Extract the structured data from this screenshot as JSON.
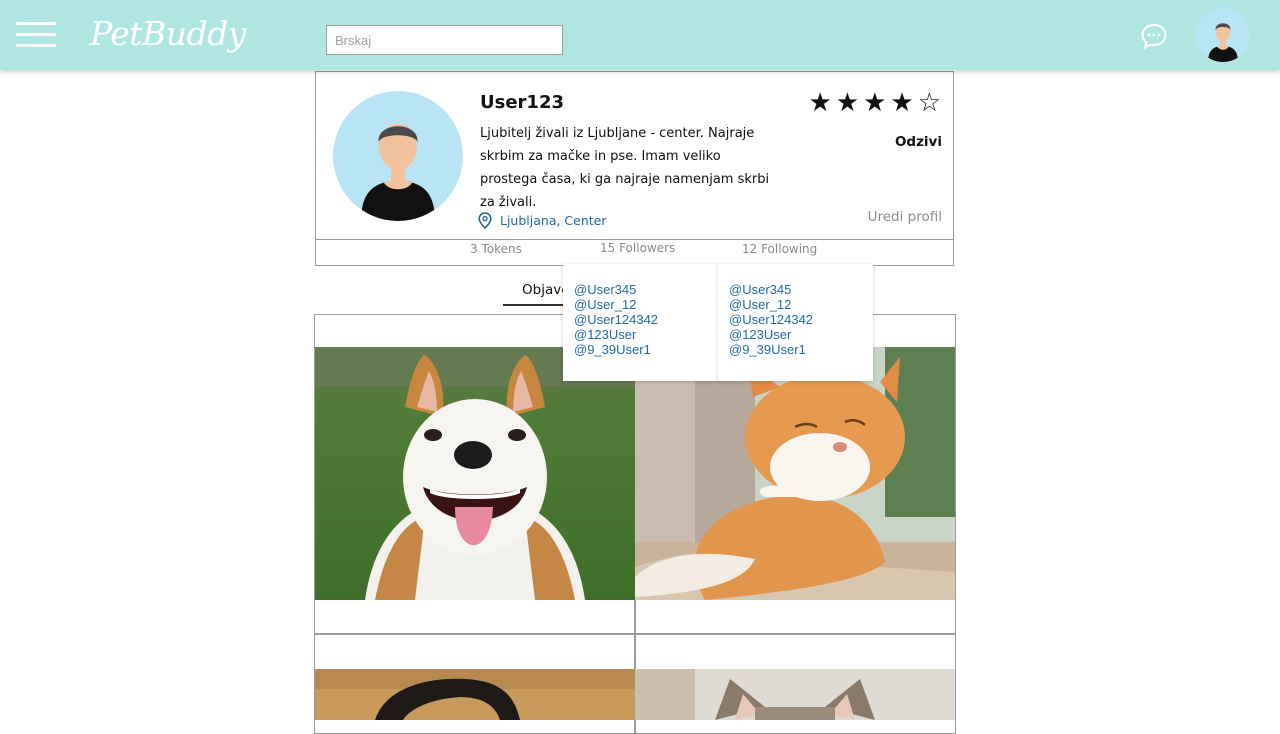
{
  "app": {
    "logo_text": "PetBuddy",
    "accent_color": "#b0e6e2",
    "link_color": "#1f6aa5"
  },
  "header": {
    "search_placeholder": "Brskaj",
    "menu_icon": "hamburger-icon",
    "chat_icon": "chat-bubble-icon"
  },
  "profile": {
    "username": "User123",
    "bio": "Ljubitelj živali iz Ljubljane - center. Najraje skrbim za mačke in pse. Imam veliko prostega časa, ki ga najraje namenjam skrbi za živali.",
    "location": "Ljubljana, Center",
    "rating_stars": [
      "★",
      "★",
      "★",
      "★",
      "☆"
    ],
    "rating_value": 4,
    "rating_max": 5,
    "reviews_label": "Odzivi",
    "edit_label": "Uredi profil"
  },
  "stats": {
    "tokens": "3 Tokens",
    "followers": "15 Followers",
    "following": "12 Following"
  },
  "tabs": {
    "posts_label": "Objave"
  },
  "followers_list": [
    "@User345",
    "@User_12",
    "@User124342",
    "@123User",
    "@9_39User1"
  ],
  "following_list": [
    "@User345",
    "@User_12",
    "@User124342",
    "@123User",
    "@9_39User1"
  ],
  "posts": [
    {
      "subject": "dog"
    },
    {
      "subject": "cat"
    },
    {
      "subject": "dog"
    },
    {
      "subject": "cat"
    }
  ]
}
